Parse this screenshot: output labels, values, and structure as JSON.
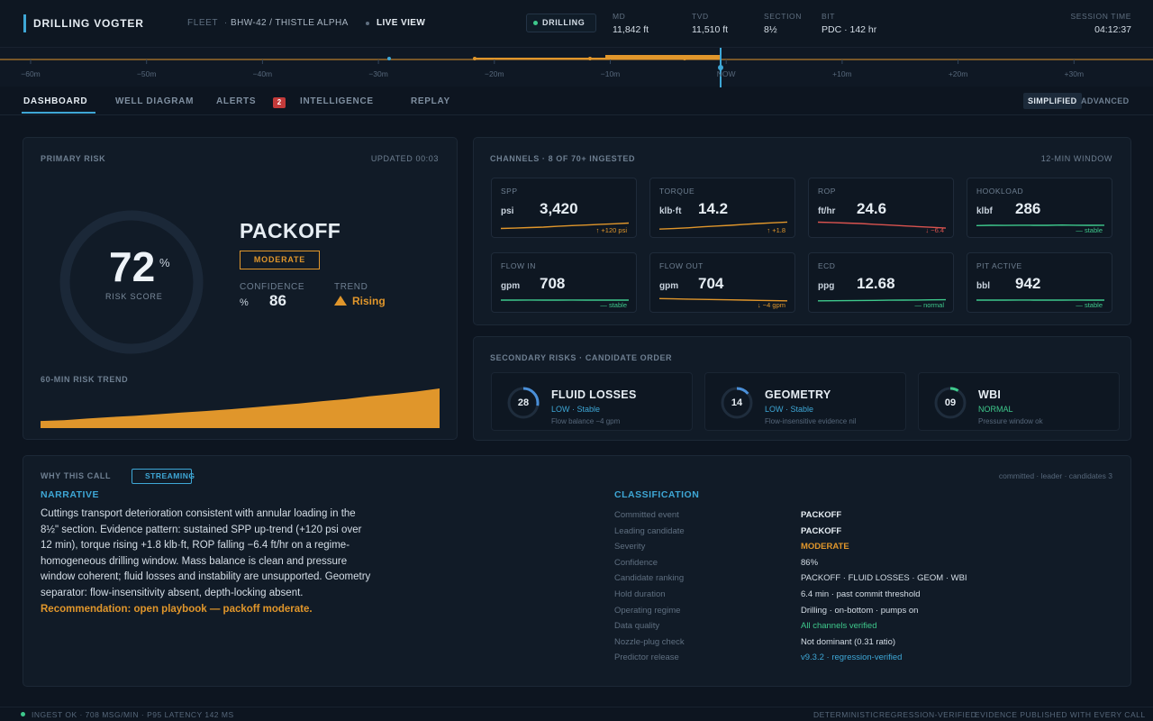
{
  "app": {
    "brand": "DRILLING VOGTER",
    "fleet_label": "FLEET",
    "separator": "·",
    "rig": "BHW-42 / THISTLE ALPHA",
    "live_view": "LIVE VIEW",
    "state": "DRILLING",
    "state_color": "#3ec98c",
    "stats": [
      {
        "label": "MD",
        "value": "11,842 ft"
      },
      {
        "label": "TVD",
        "value": "11,510 ft"
      },
      {
        "label": "SECTION",
        "value": "8½"
      },
      {
        "label": "BIT",
        "value": "PDC · 142 hr"
      }
    ],
    "session_label": "SESSION TIME",
    "session_value": "04:12:37"
  },
  "timeline": {
    "ticks": [
      "−60m",
      "−50m",
      "−40m",
      "−30m",
      "−20m",
      "−10m",
      "NOW",
      "+10m",
      "+20m",
      "+30m"
    ],
    "accent": "#e0962b",
    "now_color": "#3ea7d6"
  },
  "nav": {
    "tabs": [
      "DASHBOARD",
      "WELL DIAGRAM",
      "ALERTS",
      "INTELLIGENCE",
      "REPLAY"
    ],
    "alert_count": "2",
    "modes": [
      "SIMPLIFIED",
      "ADVANCED"
    ]
  },
  "primary": {
    "title": "PRIMARY RISK",
    "updated": "UPDATED 00:03",
    "score": "72",
    "score_unit": "%",
    "score_fraction": 0.72,
    "score_label": "RISK SCORE",
    "name": "PACKOFF",
    "severity": "MODERATE",
    "confidence_label": "CONFIDENCE",
    "confidence_unit": "%",
    "confidence_value": "86",
    "trend_label": "TREND",
    "trend_value": "Rising",
    "trend_chart_label": "60-MIN RISK TREND",
    "trend_points": [
      0.18,
      0.2,
      0.24,
      0.28,
      0.31,
      0.35,
      0.39,
      0.43,
      0.47,
      0.52,
      0.57,
      0.62,
      0.68,
      0.73,
      0.8,
      0.86,
      0.92,
      1.0
    ]
  },
  "channels": {
    "title": "CHANNELS · 8 OF 70+ INGESTED",
    "window": "12-MIN WINDOW",
    "items": [
      {
        "name": "SPP",
        "unit": "psi",
        "value": "3,420",
        "note": "↑ +120 psi",
        "color": "#e0962b",
        "trend": [
          0.25,
          0.28,
          0.32,
          0.36,
          0.42,
          0.48,
          0.52,
          0.58,
          0.62,
          0.68
        ]
      },
      {
        "name": "TORQUE",
        "unit": "klb·ft",
        "value": "14.2",
        "note": "↑ +1.8",
        "color": "#e0962b",
        "trend": [
          0.2,
          0.24,
          0.3,
          0.38,
          0.44,
          0.5,
          0.58,
          0.64,
          0.7,
          0.76
        ]
      },
      {
        "name": "ROP",
        "unit": "ft/hr",
        "value": "24.6",
        "note": "↓ −6.4",
        "color": "#d9534f",
        "trend": [
          0.75,
          0.72,
          0.68,
          0.64,
          0.58,
          0.52,
          0.46,
          0.4,
          0.34,
          0.28
        ]
      },
      {
        "name": "HOOKLOAD",
        "unit": "klbf",
        "value": "286",
        "note": "— stable",
        "color": "#3ec98c",
        "trend": [
          0.48,
          0.5,
          0.49,
          0.51,
          0.5,
          0.5,
          0.52,
          0.51,
          0.5,
          0.51
        ]
      },
      {
        "name": "FLOW IN",
        "unit": "gpm",
        "value": "708",
        "note": "— stable",
        "color": "#3ec98c",
        "trend": [
          0.5,
          0.5,
          0.51,
          0.5,
          0.5,
          0.51,
          0.5,
          0.5,
          0.5,
          0.5
        ]
      },
      {
        "name": "FLOW OUT",
        "unit": "gpm",
        "value": "704",
        "note": "↓ −4 gpm",
        "color": "#e0962b",
        "trend": [
          0.62,
          0.6,
          0.58,
          0.56,
          0.54,
          0.52,
          0.5,
          0.48,
          0.46,
          0.44
        ]
      },
      {
        "name": "ECD",
        "unit": "ppg",
        "value": "12.68",
        "note": "— normal",
        "color": "#3ec98c",
        "trend": [
          0.44,
          0.45,
          0.46,
          0.47,
          0.48,
          0.49,
          0.5,
          0.51,
          0.52,
          0.53
        ]
      },
      {
        "name": "PIT ACTIVE",
        "unit": "bbl",
        "value": "942",
        "note": "— stable",
        "color": "#3ec98c",
        "trend": [
          0.5,
          0.5,
          0.5,
          0.51,
          0.5,
          0.5,
          0.5,
          0.51,
          0.5,
          0.5
        ]
      }
    ]
  },
  "secondary": {
    "title": "SECONDARY RISKS · CANDIDATE ORDER",
    "items": [
      {
        "score": "28",
        "fraction": 0.28,
        "name": "FLUID LOSSES",
        "status": "LOW · Stable",
        "detail": "Flow balance −4 gpm",
        "color": "#4a8fd8",
        "status_color": "#3ea7d6"
      },
      {
        "score": "14",
        "fraction": 0.14,
        "name": "GEOMETRY",
        "status": "LOW · Stable",
        "detail": "Flow-insensitive evidence nil",
        "color": "#4a8fd8",
        "status_color": "#3ea7d6"
      },
      {
        "score": "09",
        "fraction": 0.09,
        "name": "WBI",
        "status": "NORMAL",
        "detail": "Pressure window ok",
        "color": "#3ec98c",
        "status_color": "#3ec98c"
      }
    ]
  },
  "why": {
    "title": "WHY THIS CALL",
    "streaming": "STREAMING",
    "meta": "committed · leader · candidates 3",
    "narrative_title": "NARRATIVE",
    "narrative": "Cuttings transport deterioration consistent with annular loading in the 8½\" section. Evidence pattern: sustained SPP up-trend (+120 psi over 12 min), torque rising +1.8 klb·ft, ROP falling −6.4 ft/hr on a regime-homogeneous drilling window. Mass balance is clean and pressure window coherent; fluid losses and instability are unsupported. Geometry separator: flow-insensitivity absent, depth-locking absent.",
    "recommendation": "Recommendation: open playbook — packoff moderate.",
    "classification_title": "CLASSIFICATION",
    "rows": [
      {
        "k": "Committed event",
        "v": "PACKOFF",
        "color": "#e6edf3",
        "bold": true
      },
      {
        "k": "Leading candidate",
        "v": "PACKOFF",
        "color": "#e6edf3",
        "bold": true
      },
      {
        "k": "Severity",
        "v": "MODERATE",
        "color": "#e0962b",
        "bold": true
      },
      {
        "k": "Confidence",
        "v": "86%",
        "color": "#d5dee7",
        "bold": false
      },
      {
        "k": "Candidate ranking",
        "v": "PACKOFF · FLUID LOSSES · GEOM · WBI",
        "color": "#d5dee7",
        "bold": false
      },
      {
        "k": "Hold duration",
        "v": "6.4 min · past commit threshold",
        "color": "#d5dee7",
        "bold": false
      },
      {
        "k": "Operating regime",
        "v": "Drilling · on-bottom · pumps on",
        "color": "#d5dee7",
        "bold": false
      },
      {
        "k": "Data quality",
        "v": "All channels verified",
        "color": "#3ec98c",
        "bold": false
      },
      {
        "k": "Nozzle-plug check",
        "v": "Not dominant (0.31 ratio)",
        "color": "#d5dee7",
        "bold": false
      },
      {
        "k": "Predictor release",
        "v": "v9.3.2 · regression-verified",
        "color": "#3ea7d6",
        "bold": false
      }
    ]
  },
  "footer": {
    "left": "INGEST OK · 708 MSG/MIN · P95 LATENCY 142 MS",
    "right": [
      "DETERMINISTIC",
      "REGRESSION-VERIFIED",
      "EVIDENCE PUBLISHED WITH EVERY CALL"
    ]
  }
}
